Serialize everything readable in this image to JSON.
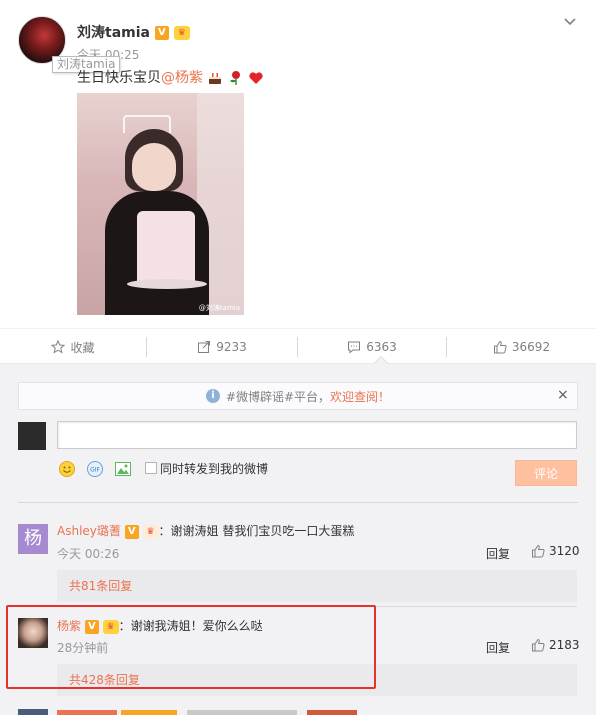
{
  "post": {
    "author": "刘涛tamia",
    "time": "今天 00:25",
    "tooltip": "刘涛tamia",
    "text_prefix": "生日快乐宝贝",
    "mention": "@杨紫",
    "photo_watermark": "@刘涛tamia",
    "badges": {
      "verified": "V"
    }
  },
  "actions": {
    "favorite": "收藏",
    "repost": "9233",
    "comment": "6363",
    "like": "36692"
  },
  "notice": {
    "prefix": "#微博辟谣#平台，",
    "link": "欢迎查阅！",
    "close": "×"
  },
  "composer": {
    "repost_label": "同时转发到我的微博",
    "submit": "评论"
  },
  "comments": [
    {
      "name": "Ashley璐蓍",
      "text": "：谢谢涛姐 替我们宝贝吃一口大蛋糕",
      "time": "今天 00:26",
      "reply": "回复",
      "likes": "3120",
      "sub_replies": "共81条回复"
    },
    {
      "name": "杨紫",
      "text": "：谢谢我涛姐！爱你么么哒",
      "time": "28分钟前",
      "reply": "回复",
      "likes": "2183",
      "sub_replies": "共428条回复"
    }
  ],
  "colors": {
    "accent": "#eb7350",
    "highlight": "#e5322d",
    "panel": "#f2f2f5",
    "button_disabled": "#ffc09f"
  }
}
